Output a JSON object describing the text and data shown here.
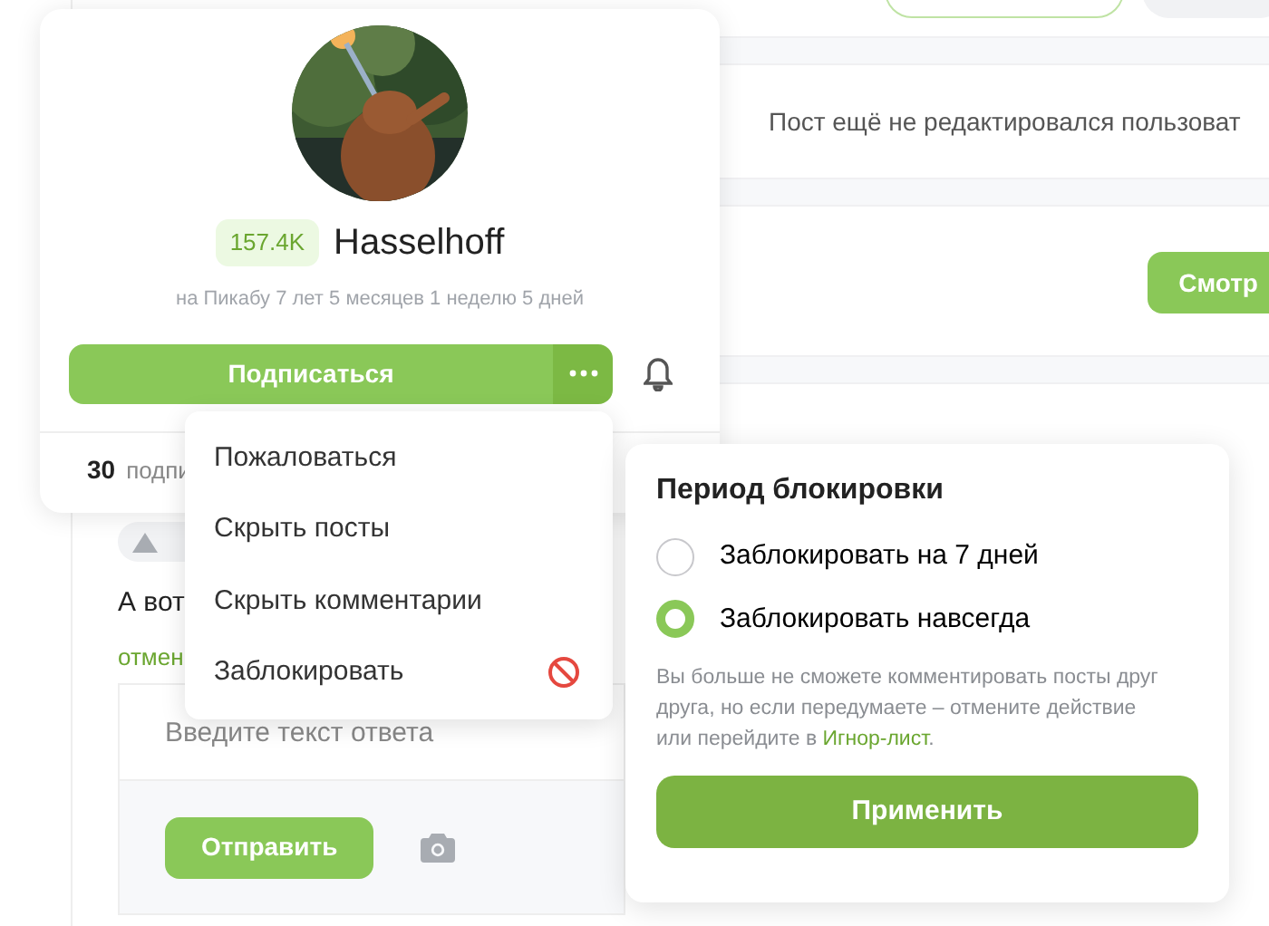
{
  "post": {
    "edit_note": "Пост ещё не редактировался пользоват",
    "view_button": "Смотр"
  },
  "comment": {
    "text": "А вот",
    "cancel_link": "отмен",
    "reply_field": {
      "placeholder": "Введите текст ответа"
    },
    "send_button": "Отправить"
  },
  "profile": {
    "rating": "157.4K",
    "name": "Hasselhoff",
    "tenure": "на Пикабу 7 лет 5 месяцев 1 неделю 5 дней",
    "subscribe_button": "Подписаться",
    "subscribers_count": "30",
    "subscribers_label": "подпи"
  },
  "menu": {
    "items": [
      {
        "label": "Пожаловаться",
        "kind": "plain"
      },
      {
        "label": "Скрыть посты",
        "kind": "plain"
      },
      {
        "label": "Скрыть комментарии",
        "kind": "plain"
      },
      {
        "label": "Заблокировать",
        "kind": "block"
      }
    ]
  },
  "block_popover": {
    "title": "Период блокировки",
    "options": [
      {
        "label": "Заблокировать на 7 дней",
        "selected": false
      },
      {
        "label": "Заблокировать навсегда",
        "selected": true
      }
    ],
    "note": "Вы больше не сможете комментировать посты друг друга, но если передумаете – отмените действие или перейдите в ",
    "note_link": "Игнор-лист",
    "note_end": ".",
    "apply_button": "Применить"
  }
}
